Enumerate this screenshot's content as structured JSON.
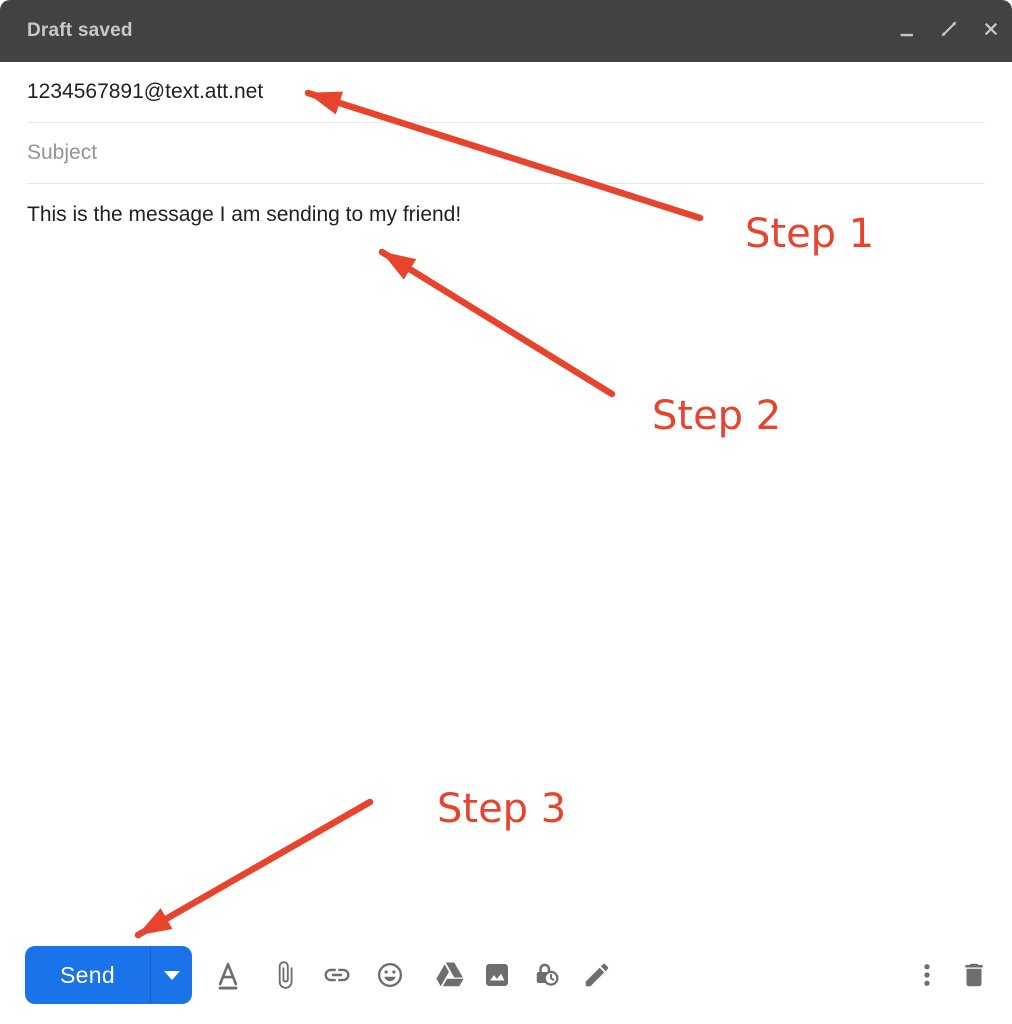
{
  "window": {
    "title": "Draft saved",
    "controls": [
      "minimize",
      "expand",
      "close"
    ]
  },
  "fields": {
    "recipient_value": "1234567891@text.att.net",
    "subject_placeholder": "Subject",
    "body_text": "This is the message I am sending to my friend!"
  },
  "annotations": {
    "color": "#e8432c",
    "steps": [
      {
        "label": "Step 1"
      },
      {
        "label": "Step 2"
      },
      {
        "label": "Step 3"
      }
    ]
  },
  "toolbar": {
    "send_label": "Send",
    "send_color": "#1a73e8",
    "icons": [
      "formatting-options",
      "attach-files",
      "insert-link",
      "insert-emoji",
      "insert-from-drive",
      "insert-photo",
      "confidential-mode",
      "insert-signature"
    ],
    "right_icons": [
      "more-options",
      "discard-draft"
    ]
  }
}
